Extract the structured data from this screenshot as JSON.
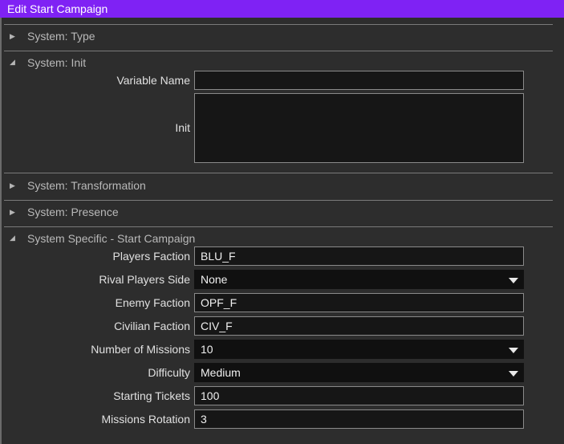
{
  "window": {
    "title": "Edit Start Campaign"
  },
  "sections": {
    "type": {
      "title": "System: Type"
    },
    "init": {
      "title": "System: Init"
    },
    "transformation": {
      "title": "System: Transformation"
    },
    "presence": {
      "title": "System: Presence"
    },
    "specific": {
      "title": "System Specific - Start Campaign"
    }
  },
  "init": {
    "variable_name": {
      "label": "Variable Name",
      "value": ""
    },
    "init": {
      "label": "Init",
      "value": ""
    }
  },
  "campaign": {
    "players_faction": {
      "label": "Players Faction",
      "value": "BLU_F"
    },
    "rival_players_side": {
      "label": "Rival Players Side",
      "value": "None"
    },
    "enemy_faction": {
      "label": "Enemy Faction",
      "value": "OPF_F"
    },
    "civilian_faction": {
      "label": "Civilian Faction",
      "value": "CIV_F"
    },
    "number_of_missions": {
      "label": "Number of Missions",
      "value": "10"
    },
    "difficulty": {
      "label": "Difficulty",
      "value": "Medium"
    },
    "starting_tickets": {
      "label": "Starting Tickets",
      "value": "100"
    },
    "missions_rotation": {
      "label": "Missions Rotation",
      "value": "3"
    }
  },
  "colors": {
    "title_bar": "#7f22f4",
    "background": "#2d2d2d"
  }
}
